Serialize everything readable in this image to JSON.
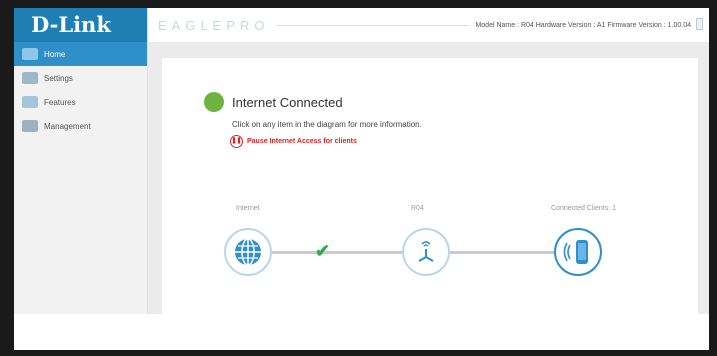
{
  "brand": {
    "logo": "D-Link",
    "product": "EAGLEPRO"
  },
  "header": {
    "model_info": "Model Name : R04 Hardware Version : A1 Firmware Version : 1.00.04"
  },
  "sidebar": {
    "items": [
      {
        "label": "Home",
        "icon": "home-icon"
      },
      {
        "label": "Settings",
        "icon": "settings-icon"
      },
      {
        "label": "Features",
        "icon": "features-icon"
      },
      {
        "label": "Management",
        "icon": "management-icon"
      }
    ]
  },
  "status": {
    "text": "Internet Connected",
    "hint": "Click on any item in the diagram for more information.",
    "pause_label": "Pause Internet Access for clients",
    "pause_icon": "pause-icon"
  },
  "diagram": {
    "internet_label": "Internet",
    "router_label": "R04",
    "clients_label": "Connected Clients: 1"
  },
  "colors": {
    "brand": "#1f7fb5",
    "active": "#2e8fc9",
    "connected": "#6cb33f",
    "alert": "#dd2222"
  }
}
